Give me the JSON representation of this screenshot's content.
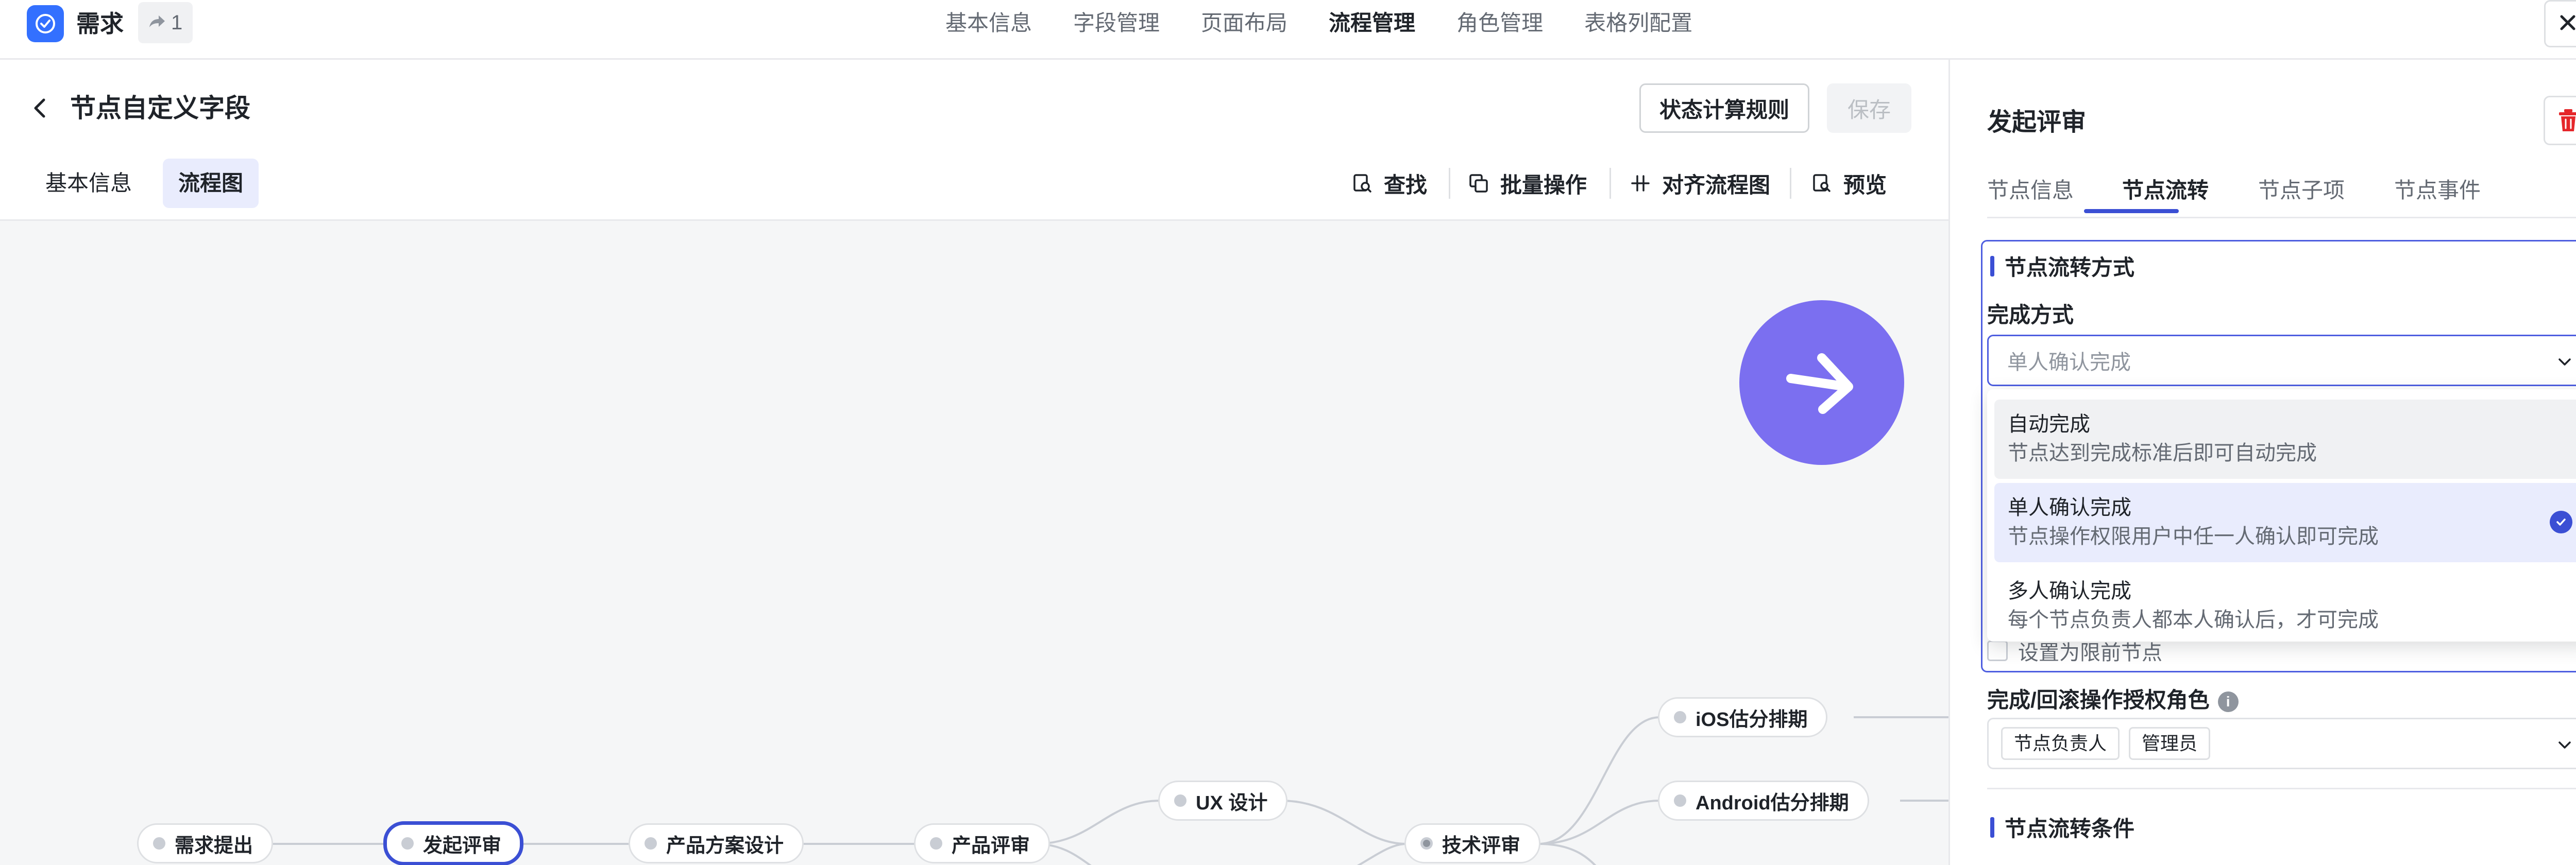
{
  "app": {
    "name": "需求",
    "share_count": "1",
    "brand_color": "#3370ff",
    "nav_tabs": [
      {
        "label": "基本信息",
        "active": false
      },
      {
        "label": "字段管理",
        "active": false
      },
      {
        "label": "页面布局",
        "active": false
      },
      {
        "label": "流程管理",
        "active": true
      },
      {
        "label": "角色管理",
        "active": false
      },
      {
        "label": "表格列配置",
        "active": false
      }
    ]
  },
  "header": {
    "title": "节点自定义字段",
    "rules_button": "状态计算规则",
    "save_button": "保存",
    "sub_tabs": [
      "基本信息",
      "流程图"
    ],
    "tools": {
      "find": "查找",
      "batch": "批量操作",
      "align": "对齐流程图",
      "preview": "预览"
    }
  },
  "flow": {
    "nodes": [
      {
        "label": "需求提出"
      },
      {
        "label": "发起评审",
        "selected": true
      },
      {
        "label": "产品方案设计"
      },
      {
        "label": "产品评审"
      },
      {
        "label": "UX 设计"
      },
      {
        "label": "技术评审"
      },
      {
        "label": "iOS估分排期"
      },
      {
        "label": "Android估分排期"
      }
    ],
    "accent_color": "#3b4fd4",
    "fab_color": "#7b6ff0"
  },
  "panel": {
    "title": "发起评审",
    "tabs": [
      {
        "label": "节点信息",
        "active": false
      },
      {
        "label": "节点流转",
        "active": true
      },
      {
        "label": "节点子项",
        "active": false
      },
      {
        "label": "节点事件",
        "active": false
      }
    ],
    "section_flow_mode": "节点流转方式",
    "completion_label": "完成方式",
    "completion_placeholder": "单人确认完成",
    "options": [
      {
        "title": "自动完成",
        "desc": "节点达到完成标准后即可自动完成",
        "state": "hover"
      },
      {
        "title": "单人确认完成",
        "desc": "节点操作权限用户中任一人确认即可完成",
        "state": "selected"
      },
      {
        "title": "多人确认完成",
        "desc": "每个节点负责人都本人确认后，才可完成",
        "state": "normal"
      }
    ],
    "hidden_checkbox_text": "设置为限前节点",
    "roles_label": "完成/回滚操作授权角色",
    "roles": [
      "节点负责人",
      "管理员"
    ],
    "section_conditions": "节点流转条件"
  }
}
